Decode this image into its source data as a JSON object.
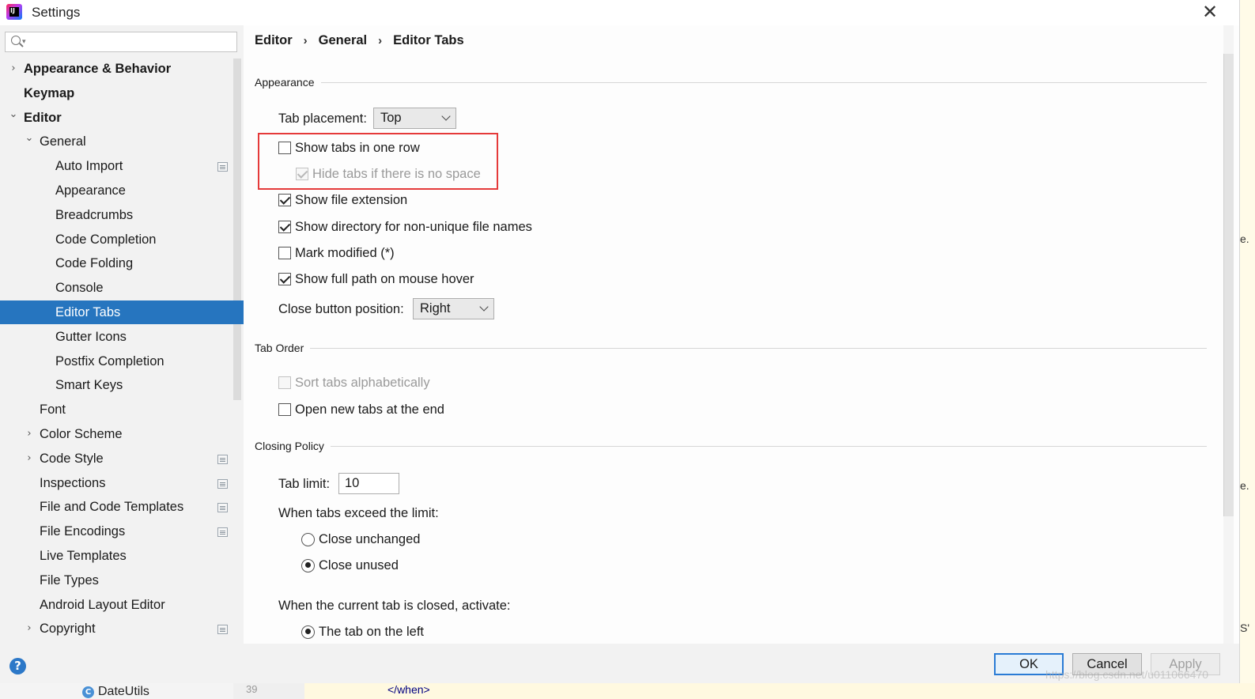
{
  "window": {
    "title": "Settings",
    "app_icon": "intellij-idea-icon"
  },
  "search": {
    "placeholder": "",
    "value": ""
  },
  "sidebar": {
    "items": [
      {
        "label": "Appearance & Behavior",
        "bold": true,
        "level": 0,
        "arrow": "right"
      },
      {
        "label": "Keymap",
        "bold": true,
        "level": 0,
        "arrow": ""
      },
      {
        "label": "Editor",
        "bold": true,
        "level": 0,
        "arrow": "down"
      },
      {
        "label": "General",
        "bold": false,
        "level": 1,
        "arrow": "down"
      },
      {
        "label": "Auto Import",
        "bold": false,
        "level": 2,
        "arrow": "",
        "project_icon": true
      },
      {
        "label": "Appearance",
        "bold": false,
        "level": 2,
        "arrow": ""
      },
      {
        "label": "Breadcrumbs",
        "bold": false,
        "level": 2,
        "arrow": ""
      },
      {
        "label": "Code Completion",
        "bold": false,
        "level": 2,
        "arrow": ""
      },
      {
        "label": "Code Folding",
        "bold": false,
        "level": 2,
        "arrow": ""
      },
      {
        "label": "Console",
        "bold": false,
        "level": 2,
        "arrow": ""
      },
      {
        "label": "Editor Tabs",
        "bold": false,
        "level": 2,
        "arrow": "",
        "selected": true
      },
      {
        "label": "Gutter Icons",
        "bold": false,
        "level": 2,
        "arrow": ""
      },
      {
        "label": "Postfix Completion",
        "bold": false,
        "level": 2,
        "arrow": ""
      },
      {
        "label": "Smart Keys",
        "bold": false,
        "level": 2,
        "arrow": ""
      },
      {
        "label": "Font",
        "bold": false,
        "level": 1,
        "arrow": ""
      },
      {
        "label": "Color Scheme",
        "bold": false,
        "level": 1,
        "arrow": "right"
      },
      {
        "label": "Code Style",
        "bold": false,
        "level": 1,
        "arrow": "right",
        "project_icon": true
      },
      {
        "label": "Inspections",
        "bold": false,
        "level": 1,
        "arrow": "",
        "project_icon": true
      },
      {
        "label": "File and Code Templates",
        "bold": false,
        "level": 1,
        "arrow": "",
        "project_icon": true
      },
      {
        "label": "File Encodings",
        "bold": false,
        "level": 1,
        "arrow": "",
        "project_icon": true
      },
      {
        "label": "Live Templates",
        "bold": false,
        "level": 1,
        "arrow": ""
      },
      {
        "label": "File Types",
        "bold": false,
        "level": 1,
        "arrow": ""
      },
      {
        "label": "Android Layout Editor",
        "bold": false,
        "level": 1,
        "arrow": ""
      },
      {
        "label": "Copyright",
        "bold": false,
        "level": 1,
        "arrow": "right",
        "project_icon": true
      }
    ]
  },
  "breadcrumb": [
    "Editor",
    "General",
    "Editor Tabs"
  ],
  "breadcrumb_separator": "›",
  "appearance": {
    "section_label": "Appearance",
    "tab_placement_label": "Tab placement:",
    "tab_placement_value": "Top",
    "show_tabs_one_row": {
      "label": "Show tabs in one row",
      "checked": false
    },
    "hide_tabs_no_space": {
      "label": "Hide tabs if there is no space",
      "checked": true,
      "disabled": true
    },
    "show_file_extension": {
      "label": "Show file extension",
      "checked": true
    },
    "show_directory": {
      "label": "Show directory for non-unique file names",
      "checked": true
    },
    "mark_modified": {
      "label": "Mark modified (*)",
      "checked": false
    },
    "show_full_path": {
      "label": "Show full path on mouse hover",
      "checked": true
    },
    "close_button_label": "Close button position:",
    "close_button_value": "Right"
  },
  "tab_order": {
    "section_label": "Tab Order",
    "sort_alpha": {
      "label": "Sort tabs alphabetically",
      "checked": false,
      "disabled": true
    },
    "open_at_end": {
      "label": "Open new tabs at the end",
      "checked": false
    }
  },
  "closing_policy": {
    "section_label": "Closing Policy",
    "tab_limit_label": "Tab limit:",
    "tab_limit_value": "10",
    "exceed_label": "When tabs exceed the limit:",
    "close_unchanged": {
      "label": "Close unchanged",
      "checked": false
    },
    "close_unused": {
      "label": "Close unused",
      "checked": true
    },
    "activate_label": "When the current tab is closed, activate:",
    "tab_on_left": {
      "label": "The tab on the left",
      "checked": true
    }
  },
  "buttons": {
    "ok": "OK",
    "cancel": "Cancel",
    "apply": "Apply"
  },
  "background": {
    "file_name": "DateUtils",
    "line_number": "39",
    "code_snippet": "</when>"
  },
  "watermark": "https://blog.csdn.net/u011066470",
  "colors": {
    "selection": "#2675bf",
    "highlight_box": "#e53a3a",
    "default_button_border": "#2a7bd5"
  }
}
